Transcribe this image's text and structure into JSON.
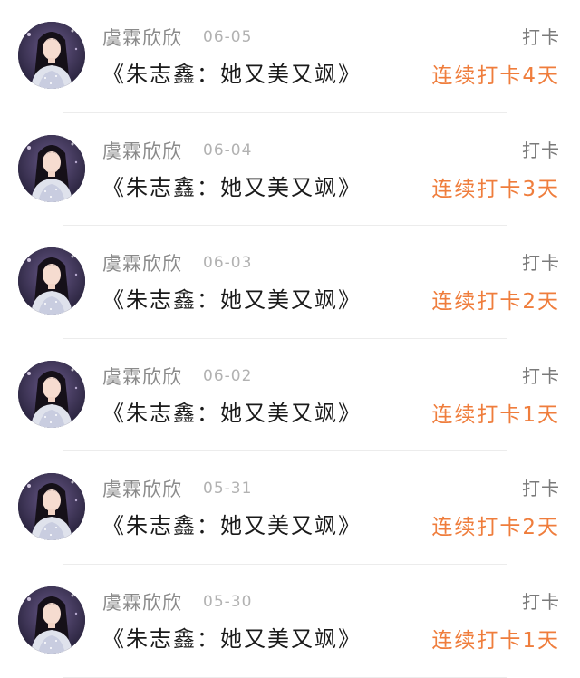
{
  "entries": [
    {
      "username": "虞霖欣欣",
      "date": "06-05",
      "action": "打卡",
      "title": "《朱志鑫：她又美又飒》",
      "streak": "连续打卡4天"
    },
    {
      "username": "虞霖欣欣",
      "date": "06-04",
      "action": "打卡",
      "title": "《朱志鑫：她又美又飒》",
      "streak": "连续打卡3天"
    },
    {
      "username": "虞霖欣欣",
      "date": "06-03",
      "action": "打卡",
      "title": "《朱志鑫：她又美又飒》",
      "streak": "连续打卡2天"
    },
    {
      "username": "虞霖欣欣",
      "date": "06-02",
      "action": "打卡",
      "title": "《朱志鑫：她又美又飒》",
      "streak": "连续打卡1天"
    },
    {
      "username": "虞霖欣欣",
      "date": "05-31",
      "action": "打卡",
      "title": "《朱志鑫：她又美又飒》",
      "streak": "连续打卡2天"
    },
    {
      "username": "虞霖欣欣",
      "date": "05-30",
      "action": "打卡",
      "title": "《朱志鑫：她又美又飒》",
      "streak": "连续打卡1天"
    }
  ],
  "colors": {
    "streak": "#ef7d3c",
    "username": "#8a8a8a",
    "date": "#b2b2b2",
    "title": "#1a1a1a",
    "divider": "#ececec"
  },
  "icons": {
    "avatar": "user-avatar-photo"
  }
}
